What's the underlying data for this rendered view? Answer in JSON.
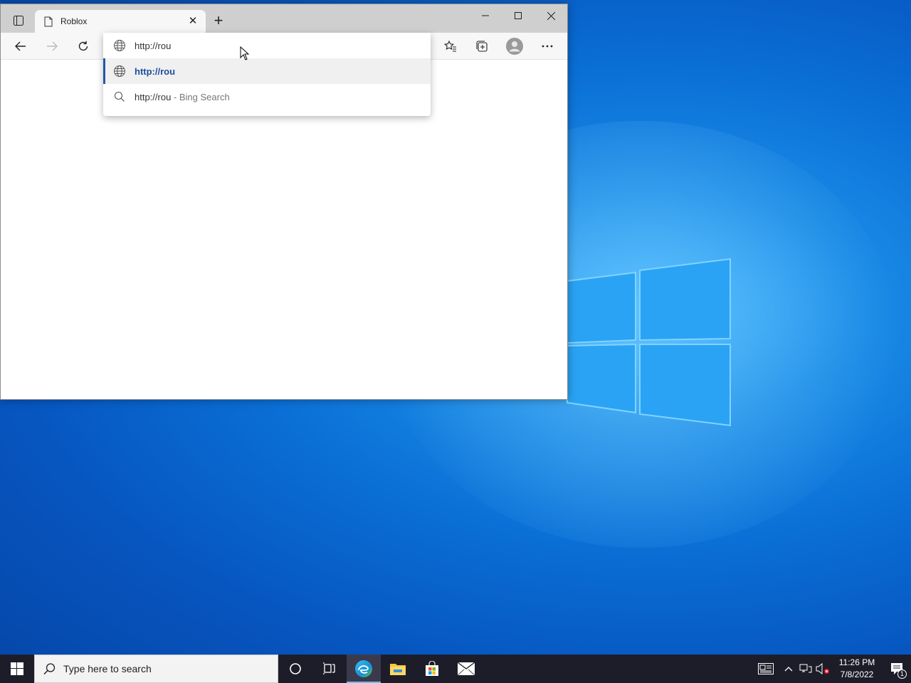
{
  "browser": {
    "tab": {
      "title": "Roblox"
    },
    "omnibox": {
      "value": "http://rou",
      "suggestions": [
        {
          "text": "http://rou"
        },
        {
          "text": "http://rou",
          "suffix": " - Bing Search"
        }
      ]
    }
  },
  "taskbar": {
    "search_placeholder": "Type here to search",
    "clock": {
      "time": "11:26 PM",
      "date": "7/8/2022"
    },
    "notification_count": "1"
  }
}
